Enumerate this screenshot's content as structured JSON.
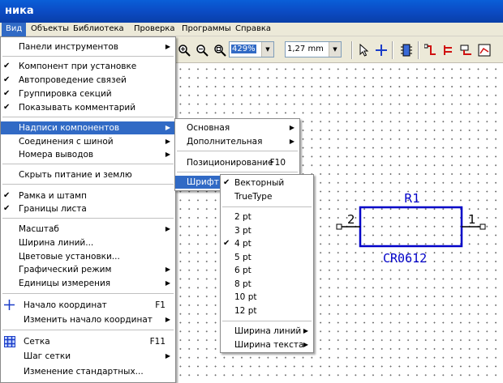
{
  "window": {
    "title": "ника"
  },
  "menubar": [
    "Вид",
    "Объекты",
    "Библиотека",
    "Проверка",
    "Программы",
    "Справка"
  ],
  "toolbar": {
    "zoom_value": "429%",
    "grid_value": "1,27 mm"
  },
  "view_menu": {
    "items": [
      {
        "label": "Панели инструментов",
        "submenu": true
      },
      {
        "label": "Компонент при установке",
        "checked": true
      },
      {
        "label": "Автопроведение связей",
        "checked": true
      },
      {
        "label": "Группировка секций",
        "checked": true
      },
      {
        "label": "Показывать комментарий",
        "checked": true
      },
      {
        "label": "Надписи компонентов",
        "submenu": true,
        "highlighted": true
      },
      {
        "label": "Соединения с шиной",
        "submenu": true
      },
      {
        "label": "Номера выводов",
        "submenu": true
      },
      {
        "label": "Скрыть питание и землю"
      },
      {
        "label": "Рамка и штамп",
        "checked": true
      },
      {
        "label": "Границы листа",
        "checked": true
      },
      {
        "label": "Масштаб",
        "submenu": true
      },
      {
        "label": "Ширина линий..."
      },
      {
        "label": "Цветовые установки..."
      },
      {
        "label": "Графический режим",
        "submenu": true
      },
      {
        "label": "Единицы измерения",
        "submenu": true
      },
      {
        "label": "Начало координат",
        "shortcut": "F1",
        "icon": "origin-cross-icon"
      },
      {
        "label": "Изменить начало координат",
        "submenu": true
      },
      {
        "label": "Сетка",
        "shortcut": "F11",
        "icon": "grid-icon"
      },
      {
        "label": "Шаг сетки",
        "submenu": true
      },
      {
        "label": "Изменение стандартных..."
      }
    ]
  },
  "labels_submenu": {
    "items": [
      {
        "label": "Основная",
        "submenu": true
      },
      {
        "label": "Дополнительная",
        "submenu": true
      },
      {
        "label": "Позиционирование",
        "shortcut": "F10"
      },
      {
        "label": "Шрифт",
        "submenu": true,
        "highlighted": true
      }
    ]
  },
  "font_submenu": {
    "items": [
      {
        "label": "Векторный",
        "checked": true
      },
      {
        "label": "TrueType"
      },
      {
        "label": "2 pt"
      },
      {
        "label": "3 pt"
      },
      {
        "label": "4 pt",
        "checked": true
      },
      {
        "label": "5 pt"
      },
      {
        "label": "6 pt"
      },
      {
        "label": "8 pt"
      },
      {
        "label": "10 pt"
      },
      {
        "label": "12 pt"
      },
      {
        "label": "Ширина линий",
        "submenu": true
      },
      {
        "label": "Ширина текста",
        "submenu": true
      }
    ]
  },
  "component": {
    "refdes": "R1",
    "value": "CR0612",
    "pin_left": "2",
    "pin_right": "1",
    "color": "#0000c8",
    "pin_color": "#000000"
  },
  "colors": {
    "highlight": "#316ac5",
    "menu_bg": "#ffffff",
    "title_bar": "#0b4bc4"
  }
}
